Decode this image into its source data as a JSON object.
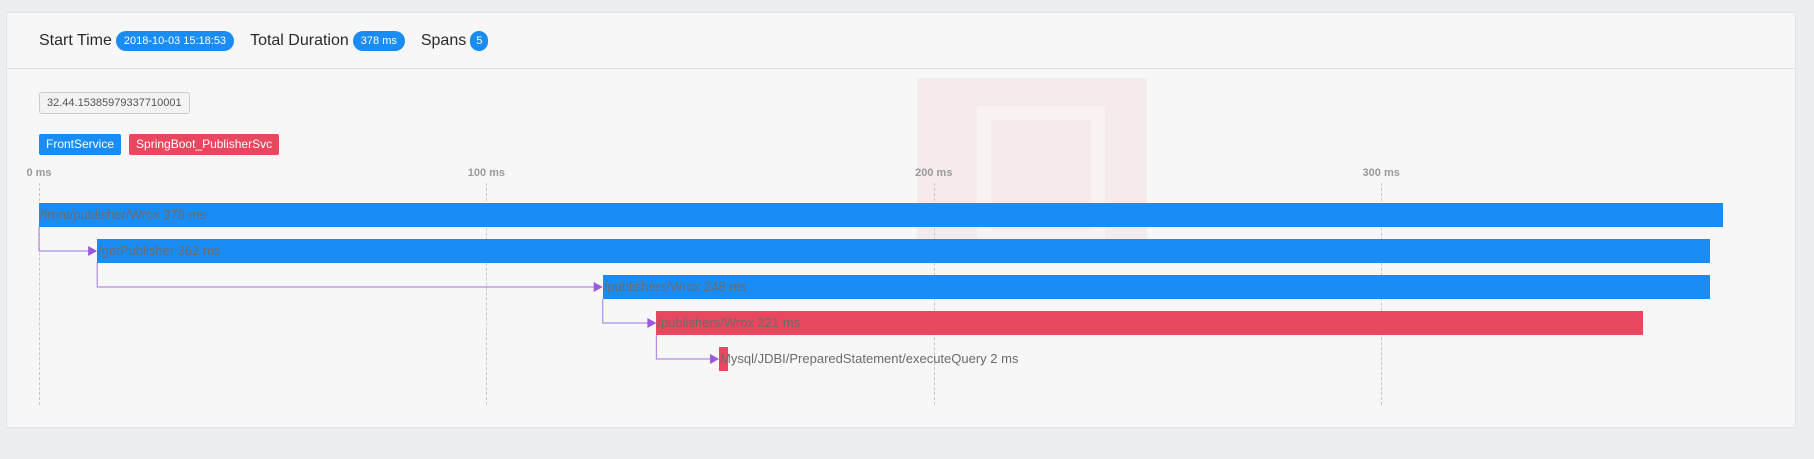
{
  "header": {
    "start_time_label": "Start Time",
    "start_time_value": "2018-10-03 15:18:53",
    "duration_label": "Total Duration",
    "duration_value": "378 ms",
    "spans_label": "Spans",
    "spans_value": "5"
  },
  "trace_id": "32.44.15385979337710001",
  "legend": [
    {
      "name": "FrontService",
      "color": "#1a8cf5"
    },
    {
      "name": "SpringBoot_PublisherSvc",
      "color": "#e8475f"
    }
  ],
  "axis": {
    "unit": "ms",
    "ticks": [
      {
        "value": 0,
        "label": "0 ms"
      },
      {
        "value": 100,
        "label": "100 ms"
      },
      {
        "value": 200,
        "label": "200 ms"
      },
      {
        "value": 300,
        "label": "300 ms"
      }
    ],
    "max": 378
  },
  "spans": [
    {
      "label": "/front/publisher/Wrox 378 ms",
      "start": 0,
      "duration": 376.5,
      "service": "FrontService",
      "parent": null
    },
    {
      "label": "/getPublisher 362 ms",
      "start": 13,
      "duration": 360.5,
      "service": "FrontService",
      "parent": 0
    },
    {
      "label": "/publishers/Wrox 248 ms",
      "start": 126,
      "duration": 247.5,
      "service": "FrontService",
      "parent": 1
    },
    {
      "label": "/publishers/Wrox 221 ms",
      "start": 138,
      "duration": 220.5,
      "service": "SpringBoot_PublisherSvc",
      "parent": 2
    },
    {
      "label": "Mysql/JDBI/PreparedStatement/executeQuery 2 ms",
      "start": 152,
      "duration": 2,
      "service": "SpringBoot_PublisherSvc",
      "parent": 3
    }
  ]
}
